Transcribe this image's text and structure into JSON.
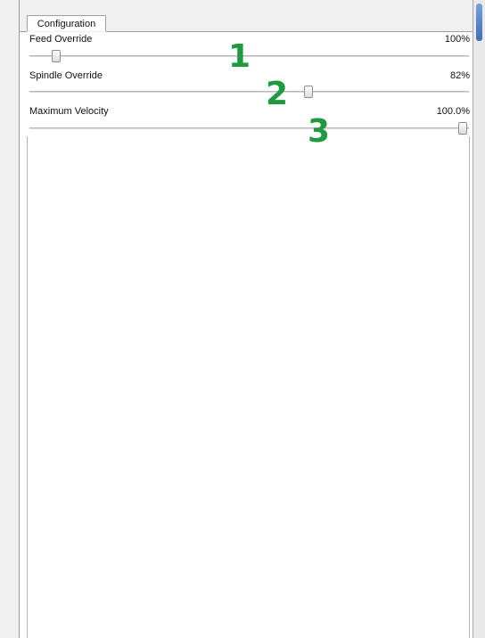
{
  "tab": {
    "label": "Configuration"
  },
  "sliders": [
    {
      "label": "Feed Override",
      "value_text": "100%",
      "callout": "1"
    },
    {
      "label": "Spindle Override",
      "value_text": "82%",
      "callout": "2"
    },
    {
      "label": "Maximum Velocity",
      "value_text": "100.0%",
      "callout": "3"
    }
  ],
  "colors": {
    "callout": "#1f9a3f",
    "panel": "#ffffff",
    "scroll_thumb": "#3d6fb8"
  }
}
